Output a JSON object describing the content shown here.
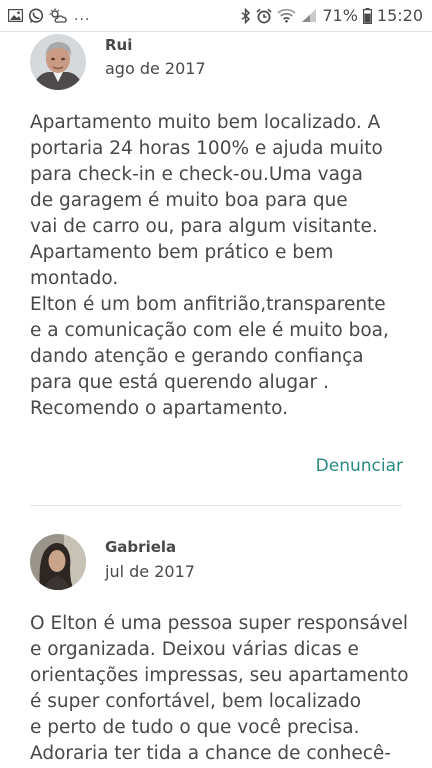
{
  "status_bar": {
    "left_icons": [
      "image-icon",
      "whatsapp-icon",
      "weather-icon"
    ],
    "more": "...",
    "right_icons": [
      "bluetooth-icon",
      "alarm-icon",
      "wifi-icon",
      "signal-icon",
      "battery-icon"
    ],
    "battery": "71%",
    "time": "15:20"
  },
  "reviews": [
    {
      "name": "Rui",
      "date": "ago de 2017",
      "text": "Apartamento muito bem localizado. A\nportaria 24 horas 100% e ajuda muito\npara check-in e check-ou.Uma vaga\nde garagem é muito boa para que\nvai de carro ou, para algum visitante.\nApartamento bem prático e bem\nmontado.\nElton é um bom anfitrião,transparente\ne a comunicação com ele é muito boa,\ndando atenção e gerando confiança\npara que está querendo alugar .\nRecomendo o apartamento.",
      "report_label": "Denunciar"
    },
    {
      "name": "Gabriela",
      "date": "jul de 2017",
      "text": "O Elton é uma pessoa super responsável\ne organizada. Deixou várias dicas e\norientações impressas, seu apartamento\né super confortável, bem localizado\ne perto de tudo o que você precisa.\nAdoraria ter tida a chance de conhecê-"
    }
  ],
  "colors": {
    "text": "#484848",
    "link": "#2a8a84",
    "divider": "#e6e6e6"
  }
}
